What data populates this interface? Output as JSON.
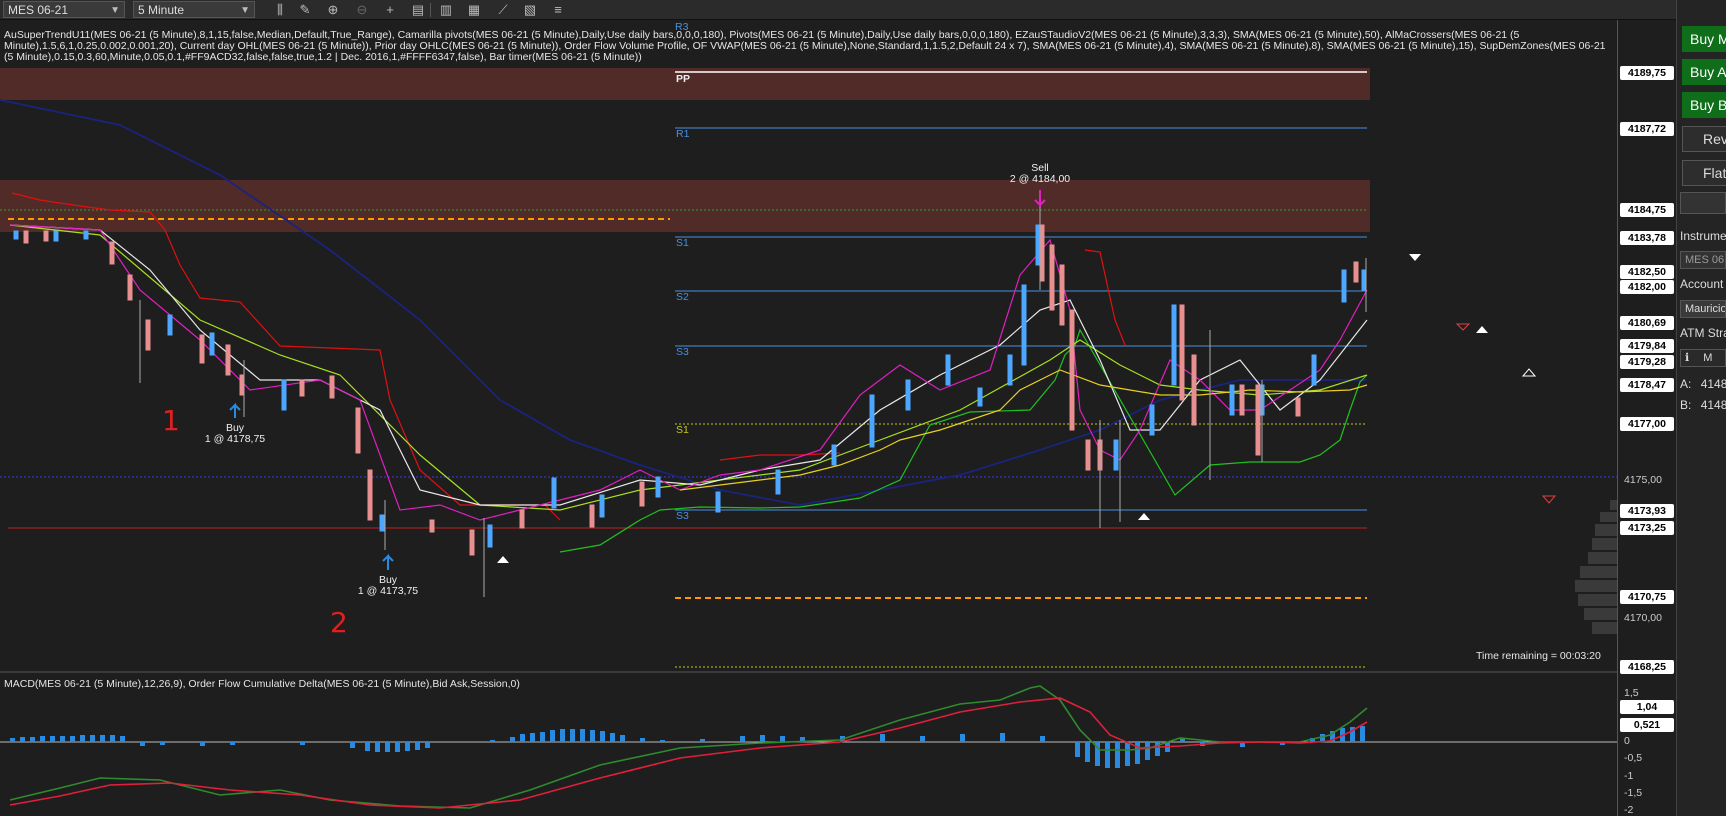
{
  "toolbar": {
    "instrument_select": "MES 06-21",
    "interval_select": "5 Minute"
  },
  "legend": {
    "indicators_text": "AuSuperTrendU11(MES 06-21 (5 Minute),8,1,15,false,Median,Default,True_Range), Camarilla pivots(MES 06-21 (5 Minute),Daily,Use daily bars,0,0,0,180), Pivots(MES 06-21 (5 Minute),Daily,Use daily bars,0,0,0,180), EZauSTaudioV2(MES 06-21 (5 Minute),3,3,3), SMA(MES 06-21 (5 Minute),50), AlMaCrossers(MES 06-21 (5 Minute),1.5,6,1,0.25,0.002,0.001,20), Current day OHL(MES 06-21 (5 Minute)), Prior day OHLC(MES 06-21 (5 Minute)), Order Flow Volume Profile, OF VWAP(MES 06-21 (5 Minute),None,Standard,1,1.5,2,Default 24 x 7), SMA(MES 06-21 (5 Minute),4), SMA(MES 06-21 (5 Minute),8), SMA(MES 06-21 (5 Minute),15), SupDemZones(MES 06-21 (5 Minute),0.15,0.3,60,Minute,0.05,0.1,#FF9ACD32,false,false,true,1.2 | Dec. 2016,1,#FFFF6347,false), Bar timer(MES 06-21 (5 Minute))",
    "macd_text": "MACD(MES 06-21 (5 Minute),12,26,9), Order Flow Cumulative Delta(MES 06-21 (5 Minute),Bid Ask,Session,0)",
    "time_remaining": "Time remaining = 00:03:20"
  },
  "pivot_labels": {
    "r3": "R3",
    "pp": "PP",
    "r1": "R1",
    "s1": "S1",
    "s2": "S2",
    "s3": "S3",
    "s1_yellow": "S1",
    "s3b": "S3"
  },
  "trades": {
    "buy1": {
      "action": "Buy",
      "detail": "1 @ 4178,75"
    },
    "buy2": {
      "action": "Buy",
      "detail": "1 @ 4173,75"
    },
    "sell1": {
      "action": "Sell",
      "detail": "2 @ 4184,00"
    }
  },
  "handwritten": {
    "mark1": "1",
    "mark2": "2"
  },
  "price_axis": {
    "labels": [
      {
        "text": "4189,75",
        "style": "white"
      },
      {
        "text": "4187,72",
        "style": "white"
      },
      {
        "text": "4184,75",
        "style": "white"
      },
      {
        "text": "4183,78",
        "style": "white"
      },
      {
        "text": "4182,50",
        "style": "white"
      },
      {
        "text": "4182,00",
        "style": "white"
      },
      {
        "text": "4180,69",
        "style": "white"
      },
      {
        "text": "4179,84",
        "style": "white"
      },
      {
        "text": "4179,28",
        "style": "white"
      },
      {
        "text": "4178,47",
        "style": "white"
      },
      {
        "text": "4177,00",
        "style": "white"
      },
      {
        "text": "4173,93",
        "style": "white"
      },
      {
        "text": "4173,25",
        "style": "white"
      },
      {
        "text": "4170,75",
        "style": "white"
      },
      {
        "text": "4168,25",
        "style": "white"
      }
    ],
    "plain": [
      "4175,00",
      "4170,00"
    ]
  },
  "macd_axis": {
    "labels": [
      "1,04",
      "0,521"
    ],
    "plain": [
      "1,5",
      "0,5",
      "0",
      "-0,5",
      "-1",
      "-1,5",
      "-2"
    ]
  },
  "right_panel": {
    "buy_market": "Buy M",
    "buy_ask": "Buy A",
    "buy_bid": "Buy B",
    "reverse": "Rev",
    "flatten": "Flat",
    "instrument_label": "Instrume",
    "instrument_value": "MES 06",
    "account_label": "Account",
    "account_value": "Mauricio",
    "atm_label": "ATM Stra",
    "info_icon_text": "M",
    "ask_label": "A:",
    "ask_value": "4148",
    "bid_label": "B:",
    "bid_value": "4148"
  },
  "colors": {
    "background": "#1e1e1e",
    "up_candle": "#4da6ff",
    "down_candle": "#e89090",
    "pivot_line": "#4a90e2",
    "supertrend_red": "#e01010",
    "supertrend_green": "#20c020",
    "sma50": "#1a237e",
    "macd": "#2e8b2e",
    "signal": "#e0203a",
    "hist": "#2a8ae0"
  }
}
